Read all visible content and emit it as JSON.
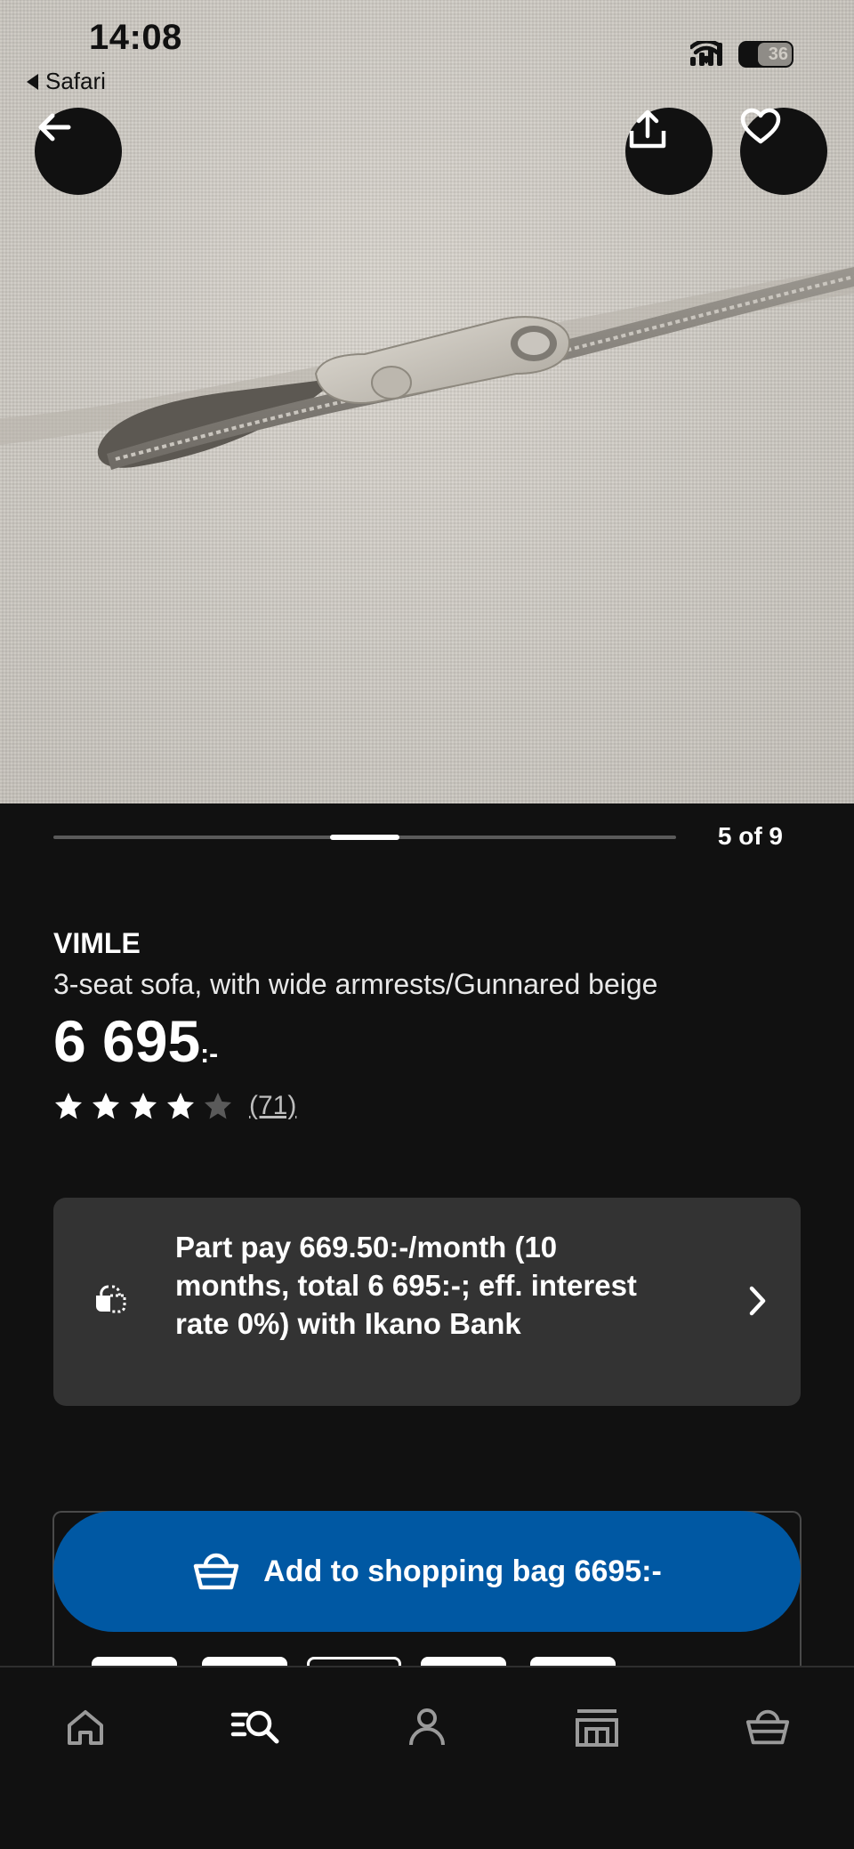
{
  "status_bar": {
    "time": "14:08",
    "back_app": "Safari",
    "battery": "36"
  },
  "hero": {
    "image_subject": "beige woven fabric with zipper",
    "back_icon": "arrow-left-icon",
    "share_icon": "share-icon",
    "favourite_icon": "heart-icon"
  },
  "carousel": {
    "counter": "5 of 9",
    "current": 5,
    "total": 9
  },
  "product": {
    "brand": "VIMLE",
    "description": "3-seat sofa, with wide armrests/Gunnared beige",
    "price": "6 695",
    "price_suffix": ":-",
    "rating_value": 4,
    "rating_max": 5,
    "review_count": "(71)"
  },
  "payment": {
    "text": "Part pay 669.50:-/month (10 months, total 6 695:-; eff. interest rate 0%) with Ikano Bank",
    "icon": "installment-icon"
  },
  "cart": {
    "add_label": "Add to shopping bag 6695:-",
    "icon": "basket-icon"
  },
  "tab_bar": {
    "items": [
      {
        "name": "home",
        "icon": "home-icon"
      },
      {
        "name": "search",
        "icon": "search-icon"
      },
      {
        "name": "profile",
        "icon": "person-icon"
      },
      {
        "name": "stores",
        "icon": "store-icon"
      },
      {
        "name": "bag",
        "icon": "basket-icon"
      }
    ],
    "active": "search"
  },
  "colors": {
    "background": "#111111",
    "card": "#333333",
    "primary_button": "#0058a3",
    "text": "#ffffff",
    "star_filled": "#ffffff",
    "star_empty": "#5a5a5a"
  }
}
